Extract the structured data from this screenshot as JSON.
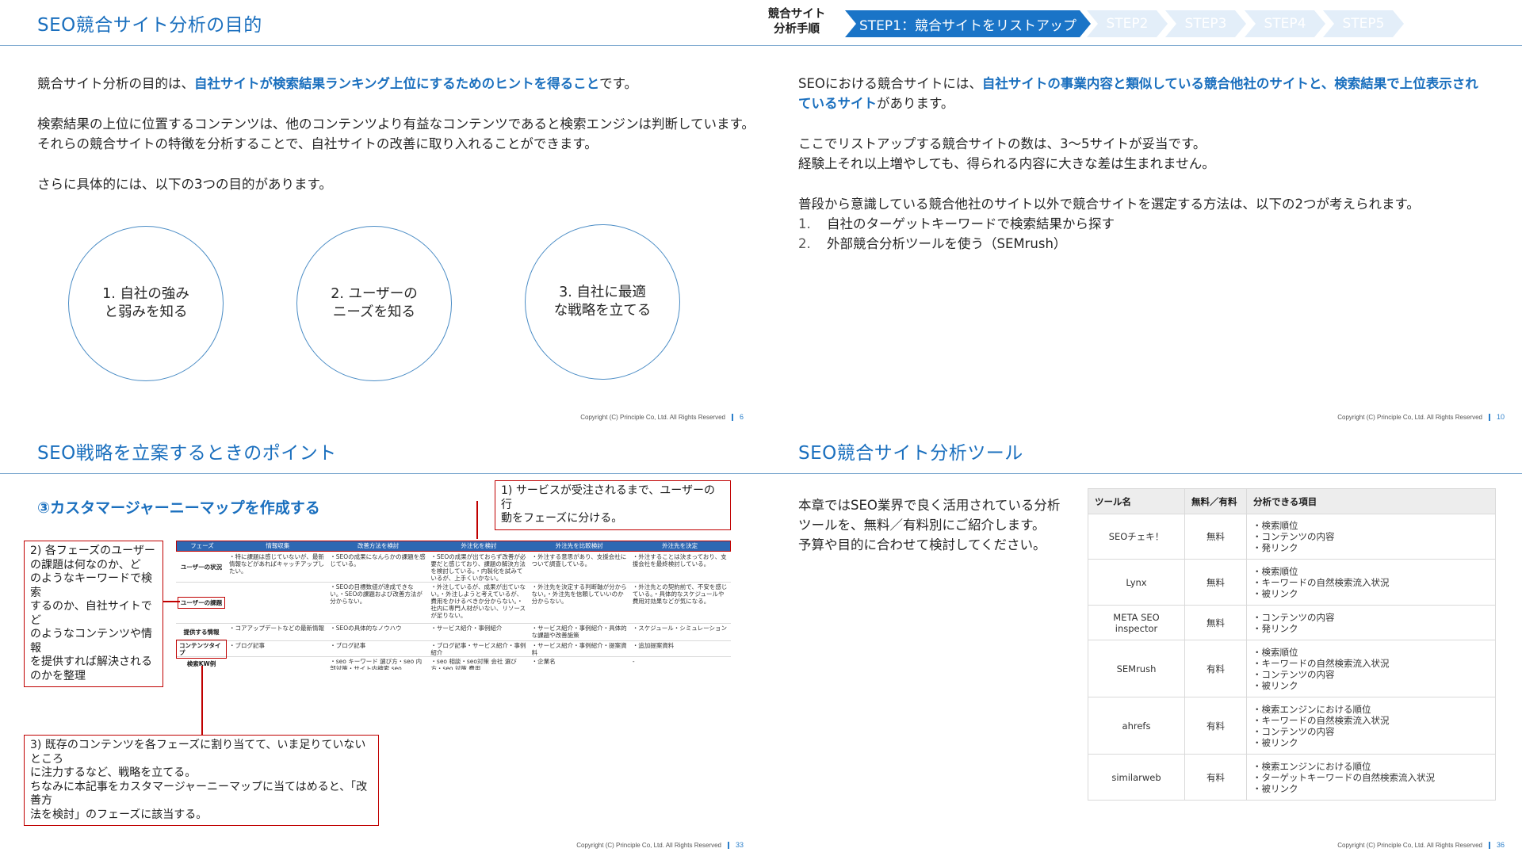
{
  "slide1": {
    "title": "SEO競合サイト分析の目的",
    "p1_pre": "競合サイト分析の目的は、",
    "p1_hl": "自社サイトが検索結果ランキング上位にするためのヒントを得ること",
    "p1_post": "です。",
    "p2_l1": "検索結果の上位に位置するコンテンツは、他のコンテンツより有益なコンテンツであると検索エンジンは判断しています。",
    "p2_l2": "それらの競合サイトの特徴を分析することで、自社サイトの改善に取り入れることができます。",
    "p3": "さらに具体的には、以下の3つの目的があります。",
    "circles": [
      {
        "l1": "1. 自社の強み",
        "l2": "と弱みを知る"
      },
      {
        "l1": "2. ユーザーの",
        "l2": "ニーズを知る"
      },
      {
        "l1": "3. 自社に最適",
        "l2": "な戦略を立てる"
      }
    ],
    "copyright": "Copyright (C) Principle Co, Ltd. All Rights Reserved",
    "page": "6"
  },
  "slide2": {
    "steps_label_l1": "競合サイト",
    "steps_label_l2": "分析手順",
    "steps": [
      "STEP1：競合サイトをリストアップ",
      "STEP2",
      "STEP3",
      "STEP4",
      "STEP5"
    ],
    "p1_pre": "SEOにおける競合サイトには、",
    "p1_hl_a": "自社サイトの事業内容と類似している競合他社のサイトと、検索結果で上位表示され",
    "p1_hl_b": "ているサイト",
    "p1_post": "があります。",
    "p2_l1": "ここでリストアップする競合サイトの数は、3～5サイトが妥当です。",
    "p2_l2": "経験上それ以上増やしても、得られる内容に大きな差は生まれません。",
    "p3": "普段から意識している競合他社のサイト以外で競合サイトを選定する方法は、以下の2つが考えられます。",
    "list": [
      {
        "n": "1.",
        "t": "自社のターゲットキーワードで検索結果から探す"
      },
      {
        "n": "2.",
        "t": "外部競合分析ツールを使う（SEMrush）"
      }
    ],
    "copyright": "Copyright (C) Principle Co, Ltd. All Rights Reserved",
    "page": "10"
  },
  "slide3": {
    "title": "SEO戦略を立案するときのポイント",
    "subheading": "③カスタマージャーニーマップを作成する",
    "callout1_l1": "1) サービスが受注されるまで、ユーザーの行",
    "callout1_l2": "動をフェーズに分ける。",
    "callout2": [
      "2) 各フェーズのユーザー",
      "の課題は何なのか、ど",
      "のようなキーワードで検索",
      "するのか、自社サイトでど",
      "のようなコンテンツや情報",
      "を提供すれば解決される",
      "のかを整理"
    ],
    "callout3": [
      "3) 既存のコンテンツを各フェーズに割り当てて、いま足りていないところ",
      "に注力するなど、戦略を立てる。",
      "ちなみに本記事をカスタマージャーニーマップに当てはめると、「改善方",
      "法を検討」のフェーズに該当する。"
    ],
    "map": {
      "headers": [
        "フェーズ",
        "情報収集",
        "改善方法を検討",
        "外注化を検討",
        "外注先を比較検討",
        "外注先を決定"
      ],
      "rows": [
        {
          "h": "ユーザーの状況",
          "cells": [
            "・特に課題は感じていないが、最新情報などがあればキャッチアップしたい。",
            "・SEOの成果になんらかの課題を感じている。",
            "・SEOの成果が出ておらず改善が必要だと感じており、課題の解決方法を検討している。・内製化を試みているが、上手くいかない。",
            "・外注する意思があり、支援会社について調査している。",
            "・外注することは決まっており、支援会社を最終検討している。"
          ]
        },
        {
          "h": "ユーザーの課題",
          "cells": [
            "",
            "・SEOの目標数値が達成できない。・SEOの課題および改善方法が分からない。",
            "・外注しているが、成果が出ていない。・外注しようと考えているが、費用をかけるべきか分からない。・社内に専門人材がいない、リソースが足りない。",
            "・外注先を決定する判断軸が分からない。・外注先を信頼していいのか分からない。",
            "・外注先との契約前で、不安を感じている。・具体的なスケジュールや費用対効果などが気になる。"
          ]
        },
        {
          "h": "提供する情報",
          "cells": [
            "・コアアップデートなどの最新情報",
            "・SEOの具体的なノウハウ",
            "・サービス紹介・事例紹介",
            "・サービス紹介・事例紹介・具体的な課題や改善施策",
            "・スケジュール・シミュレーション"
          ]
        },
        {
          "h": "コンテンツタイプ",
          "cells": [
            "・ブログ記事",
            "・ブログ記事",
            "・ブログ記事・サービス紹介・事例紹介",
            "・サービス紹介・事例紹介・提案資料",
            "・追加提案資料"
          ]
        },
        {
          "h": "検索KW例",
          "cells": [
            "",
            "・seo キーワード 選び方・seo 内部対策・サイト内検索 seo",
            "・seo 相談・seo対策 会社 選び方・seo 対策 費用",
            "・企業名",
            "-"
          ]
        }
      ]
    },
    "copyright": "Copyright (C) Principle Co, Ltd. All Rights Reserved",
    "page": "33"
  },
  "slide4": {
    "title": "SEO競合サイト分析ツール",
    "intro": [
      "本章ではSEO業界で良く活用されている分析",
      "ツールを、無料／有料別にご紹介します。",
      "予算や目的に合わせて検討してください。"
    ],
    "table_headers": [
      "ツール名",
      "無料／有料",
      "分析できる項目"
    ],
    "tools": [
      {
        "name": [
          "SEOチェキ！"
        ],
        "fee": "無料",
        "items": [
          "・検索順位",
          "・コンテンツの内容",
          "・発リンク"
        ]
      },
      {
        "name": [
          "Lynx"
        ],
        "fee": "無料",
        "items": [
          "・検索順位",
          "・キーワードの自然検索流入状況",
          "・被リンク"
        ]
      },
      {
        "name": [
          "META SEO",
          "inspector"
        ],
        "fee": "無料",
        "items": [
          "・コンテンツの内容",
          "・発リンク"
        ]
      },
      {
        "name": [
          "SEMrush"
        ],
        "fee": "有料",
        "items": [
          "・検索順位",
          "・キーワードの自然検索流入状況",
          "・コンテンツの内容",
          "・被リンク"
        ]
      },
      {
        "name": [
          "ahrefs"
        ],
        "fee": "有料",
        "items": [
          "・検索エンジンにおける順位",
          "・キーワードの自然検索流入状況",
          "・コンテンツの内容",
          "・被リンク"
        ]
      },
      {
        "name": [
          "similarweb"
        ],
        "fee": "有料",
        "items": [
          "・検索エンジンにおける順位",
          "・ターゲットキーワードの自然検索流入状況",
          "・被リンク"
        ]
      }
    ],
    "copyright": "Copyright (C) Principle Co, Ltd. All Rights Reserved",
    "page": "36"
  },
  "colors": {
    "accent": "#1a6fbe",
    "step_active": "#1a74c7",
    "step_inactive": "#e3eef9",
    "callout_border": "#c00000"
  }
}
